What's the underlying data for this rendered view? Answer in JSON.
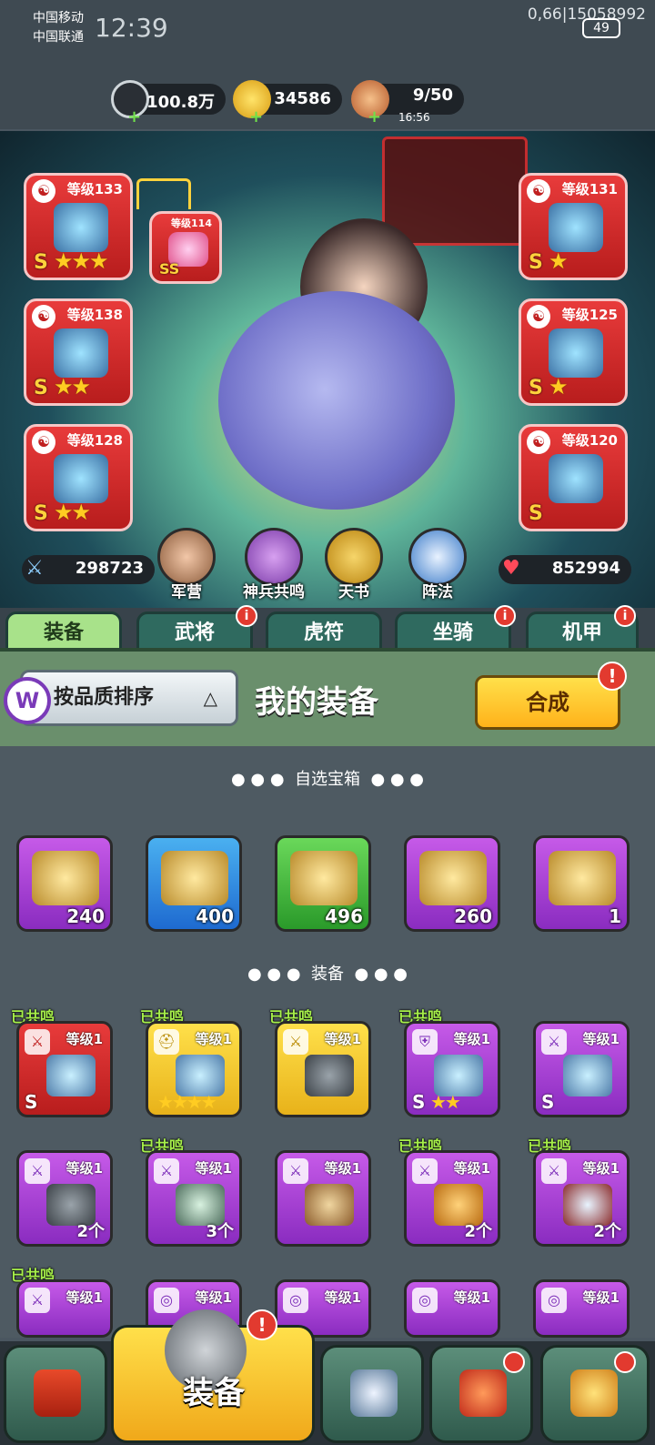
{
  "status_bar": {
    "carrier1": "中国移动",
    "carrier2": "中国联通",
    "time": "12:39",
    "net": "0,66|15058992",
    "battery": "49"
  },
  "resources": {
    "silver": "100.8万",
    "gold": "34586",
    "stamina": "9/50",
    "stamina_timer": "16:56"
  },
  "equipped": {
    "left": [
      {
        "level": "等级133",
        "grade": "S",
        "stars": "★★★"
      },
      {
        "level": "等级138",
        "grade": "S",
        "stars": "★★"
      },
      {
        "level": "等级128",
        "grade": "S",
        "stars": "★★"
      }
    ],
    "extra": {
      "level": "等级114",
      "grade": "SS"
    },
    "right": [
      {
        "level": "等级131",
        "grade": "S",
        "stars": "★"
      },
      {
        "level": "等级125",
        "grade": "S",
        "stars": "★"
      },
      {
        "level": "等级120",
        "grade": "S",
        "stars": ""
      }
    ]
  },
  "stats": {
    "attack": "298723",
    "hp": "852994"
  },
  "features": [
    "军营",
    "神兵共鸣",
    "天书",
    "阵法"
  ],
  "tabs": [
    {
      "label": "装备",
      "alert": ""
    },
    {
      "label": "武将",
      "alert": "i"
    },
    {
      "label": "虎符",
      "alert": ""
    },
    {
      "label": "坐骑",
      "alert": "i"
    },
    {
      "label": "机甲",
      "alert": "i"
    }
  ],
  "header": {
    "sort_label": "按品质排序",
    "sort_arrow": "△",
    "title": "我的装备",
    "combine_label": "合成",
    "combine_alert": "!",
    "logo": "W"
  },
  "section_chests": "自选宝箱",
  "section_equipment": "装备",
  "dots_left": "● ● ●",
  "dots_right": "● ● ●",
  "chests": [
    {
      "count": "240"
    },
    {
      "count": "400"
    },
    {
      "count": "496"
    },
    {
      "count": "260"
    },
    {
      "count": "1"
    }
  ],
  "resonated_label": "已共鸣",
  "items": [
    {
      "level": "等级1",
      "grade": "S",
      "stars": "",
      "count": ""
    },
    {
      "level": "等级1",
      "grade": "",
      "stars": "★★★★",
      "count": ""
    },
    {
      "level": "等级1",
      "grade": "",
      "stars": "",
      "count": ""
    },
    {
      "level": "等级1",
      "grade": "S",
      "stars": "★★",
      "count": ""
    },
    {
      "level": "等级1",
      "grade": "S",
      "stars": "",
      "count": ""
    },
    {
      "level": "等级1",
      "grade": "",
      "stars": "",
      "count": "2个"
    },
    {
      "level": "等级1",
      "grade": "",
      "stars": "",
      "count": "3个"
    },
    {
      "level": "等级1",
      "grade": "",
      "stars": "",
      "count": ""
    },
    {
      "level": "等级1",
      "grade": "",
      "stars": "",
      "count": "2个"
    },
    {
      "level": "等级1",
      "grade": "",
      "stars": "",
      "count": "2个"
    },
    {
      "level": "等级1",
      "grade": "",
      "stars": "",
      "count": ""
    },
    {
      "level": "等级1",
      "grade": "",
      "stars": "",
      "count": ""
    },
    {
      "level": "等级1",
      "grade": "",
      "stars": "",
      "count": ""
    },
    {
      "level": "等级1",
      "grade": "",
      "stars": "",
      "count": ""
    },
    {
      "level": "等级1",
      "grade": "",
      "stars": "",
      "count": ""
    }
  ],
  "bottom_nav": {
    "active_label": "装备",
    "alert": "!"
  },
  "colors": {
    "accent_yellow": "#ffd23c",
    "alert_red": "#e23a2f",
    "resonated_green": "#a7f04a"
  }
}
